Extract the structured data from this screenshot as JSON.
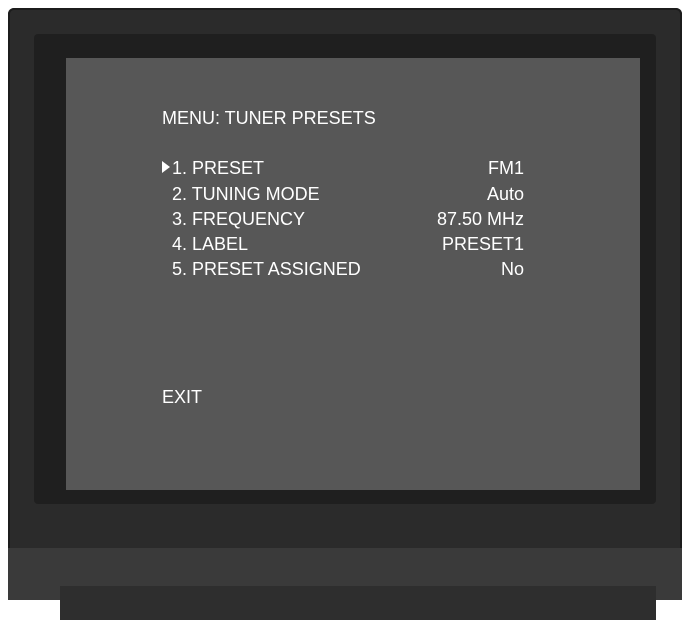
{
  "menu": {
    "title": "MENU: TUNER PRESETS",
    "items": [
      {
        "label": "1. PRESET",
        "value": "FM1",
        "selected": true
      },
      {
        "label": "2. TUNING MODE",
        "value": "Auto",
        "selected": false
      },
      {
        "label": "3. FREQUENCY",
        "value": "87.50 MHz",
        "selected": false
      },
      {
        "label": "4. LABEL",
        "value": "PRESET1",
        "selected": false
      },
      {
        "label": "5. PRESET ASSIGNED",
        "value": "No",
        "selected": false
      }
    ],
    "exit": "EXIT",
    "cursor_icon": "triangle-right-icon"
  },
  "colors": {
    "screen_background": "#575757",
    "bezel": "#2b2b2b",
    "text": "#ffffff"
  }
}
